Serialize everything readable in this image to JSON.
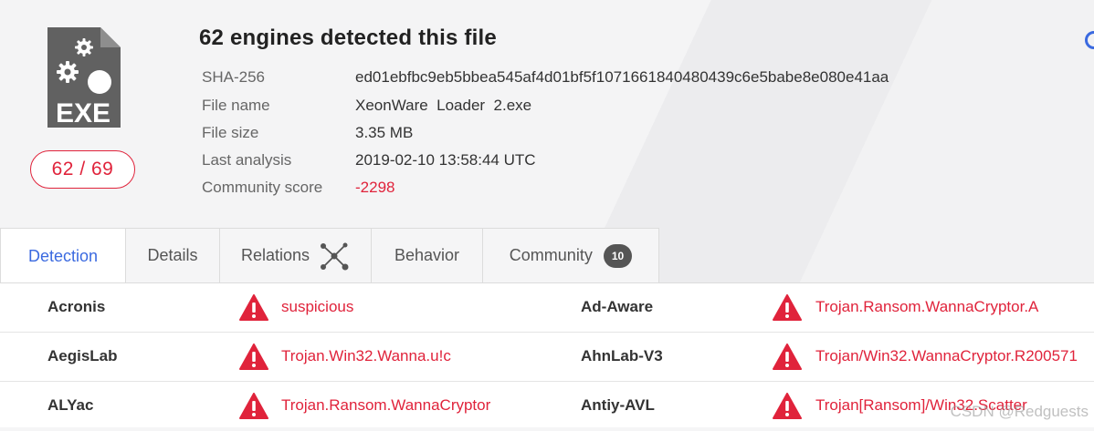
{
  "header": {
    "title": "62 engines detected this file",
    "file_type": "EXE",
    "score": "62 / 69",
    "fields": [
      {
        "label": "SHA-256",
        "value": "ed01ebfbc9eb5bbea545af4d01bf5f1071661840480439c6e5babe8e080e41aa"
      },
      {
        "label": "File name",
        "value": "XeonWare  Loader  2.exe"
      },
      {
        "label": "File size",
        "value": "3.35 MB"
      },
      {
        "label": "Last analysis",
        "value": "2019-02-10 13:58:44 UTC"
      },
      {
        "label": "Community score",
        "value": "-2298"
      }
    ]
  },
  "tabs": [
    {
      "label": "Detection"
    },
    {
      "label": "Details"
    },
    {
      "label": "Relations"
    },
    {
      "label": "Behavior"
    },
    {
      "label": "Community",
      "badge": "10"
    }
  ],
  "results": [
    [
      {
        "engine": "Acronis",
        "verdict": "suspicious"
      },
      {
        "engine": "Ad-Aware",
        "verdict": "Trojan.Ransom.WannaCryptor.A"
      }
    ],
    [
      {
        "engine": "AegisLab",
        "verdict": "Trojan.Win32.Wanna.u!c"
      },
      {
        "engine": "AhnLab-V3",
        "verdict": "Trojan/Win32.WannaCryptor.R200571"
      }
    ],
    [
      {
        "engine": "ALYac",
        "verdict": "Trojan.Ransom.WannaCryptor"
      },
      {
        "engine": "Antiy-AVL",
        "verdict": "Trojan[Ransom]/Win32.Scatter"
      }
    ]
  ],
  "watermark": "CSDN @Redguests",
  "colors": {
    "alert_red": "#e0233b",
    "active_tab_blue": "#3b6ae0",
    "icon_gray": "#616161"
  }
}
